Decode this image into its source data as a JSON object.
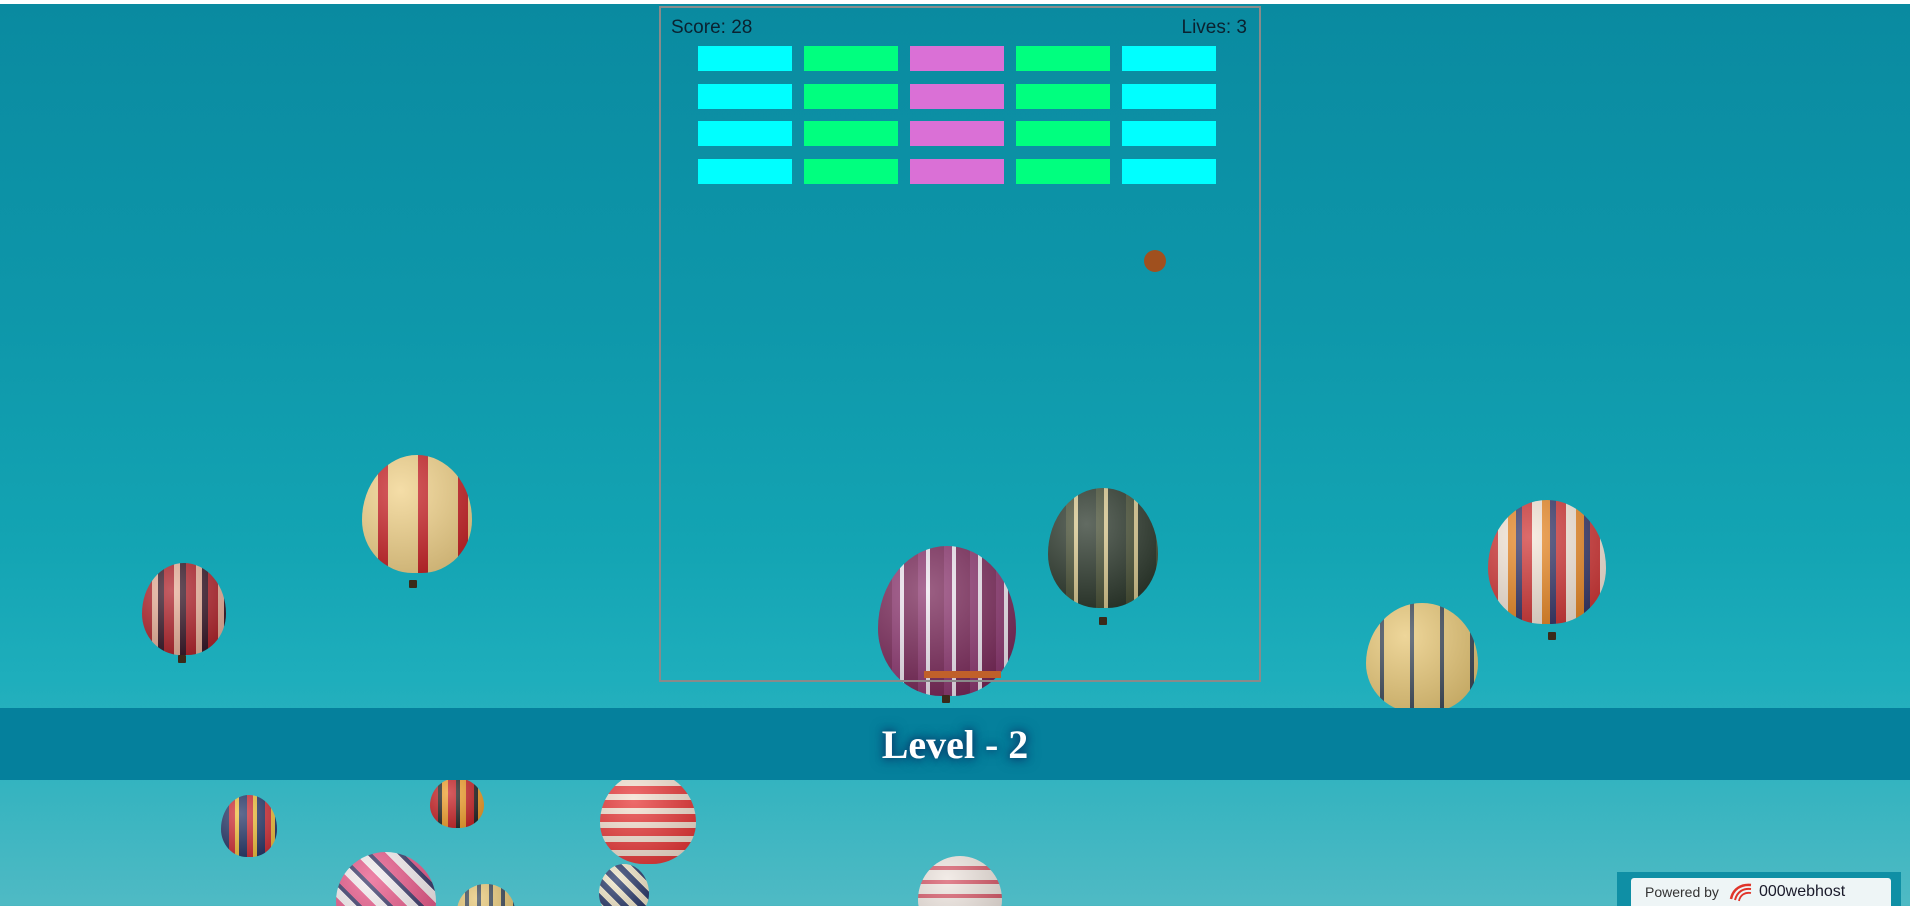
{
  "hud": {
    "score_text": "Score: 28",
    "lives_text": "Lives: 3"
  },
  "level": {
    "text": "Level - 2"
  },
  "footer": {
    "powered_label": "Powered by",
    "brand": "000webhost"
  },
  "colors": {
    "brick_cyan": "#00ffff",
    "brick_green": "#00ff7f",
    "brick_pink": "#da70d6",
    "ball": "#a0501e",
    "paddle": "#c0602a",
    "banner": "#05809c"
  },
  "bricks": {
    "rows": 4,
    "columns": [
      {
        "color": "brick_cyan"
      },
      {
        "color": "brick_green"
      },
      {
        "color": "brick_pink"
      },
      {
        "color": "brick_green"
      },
      {
        "color": "brick_cyan"
      }
    ]
  },
  "icons": {
    "logo": "000webhost-logo-icon"
  }
}
